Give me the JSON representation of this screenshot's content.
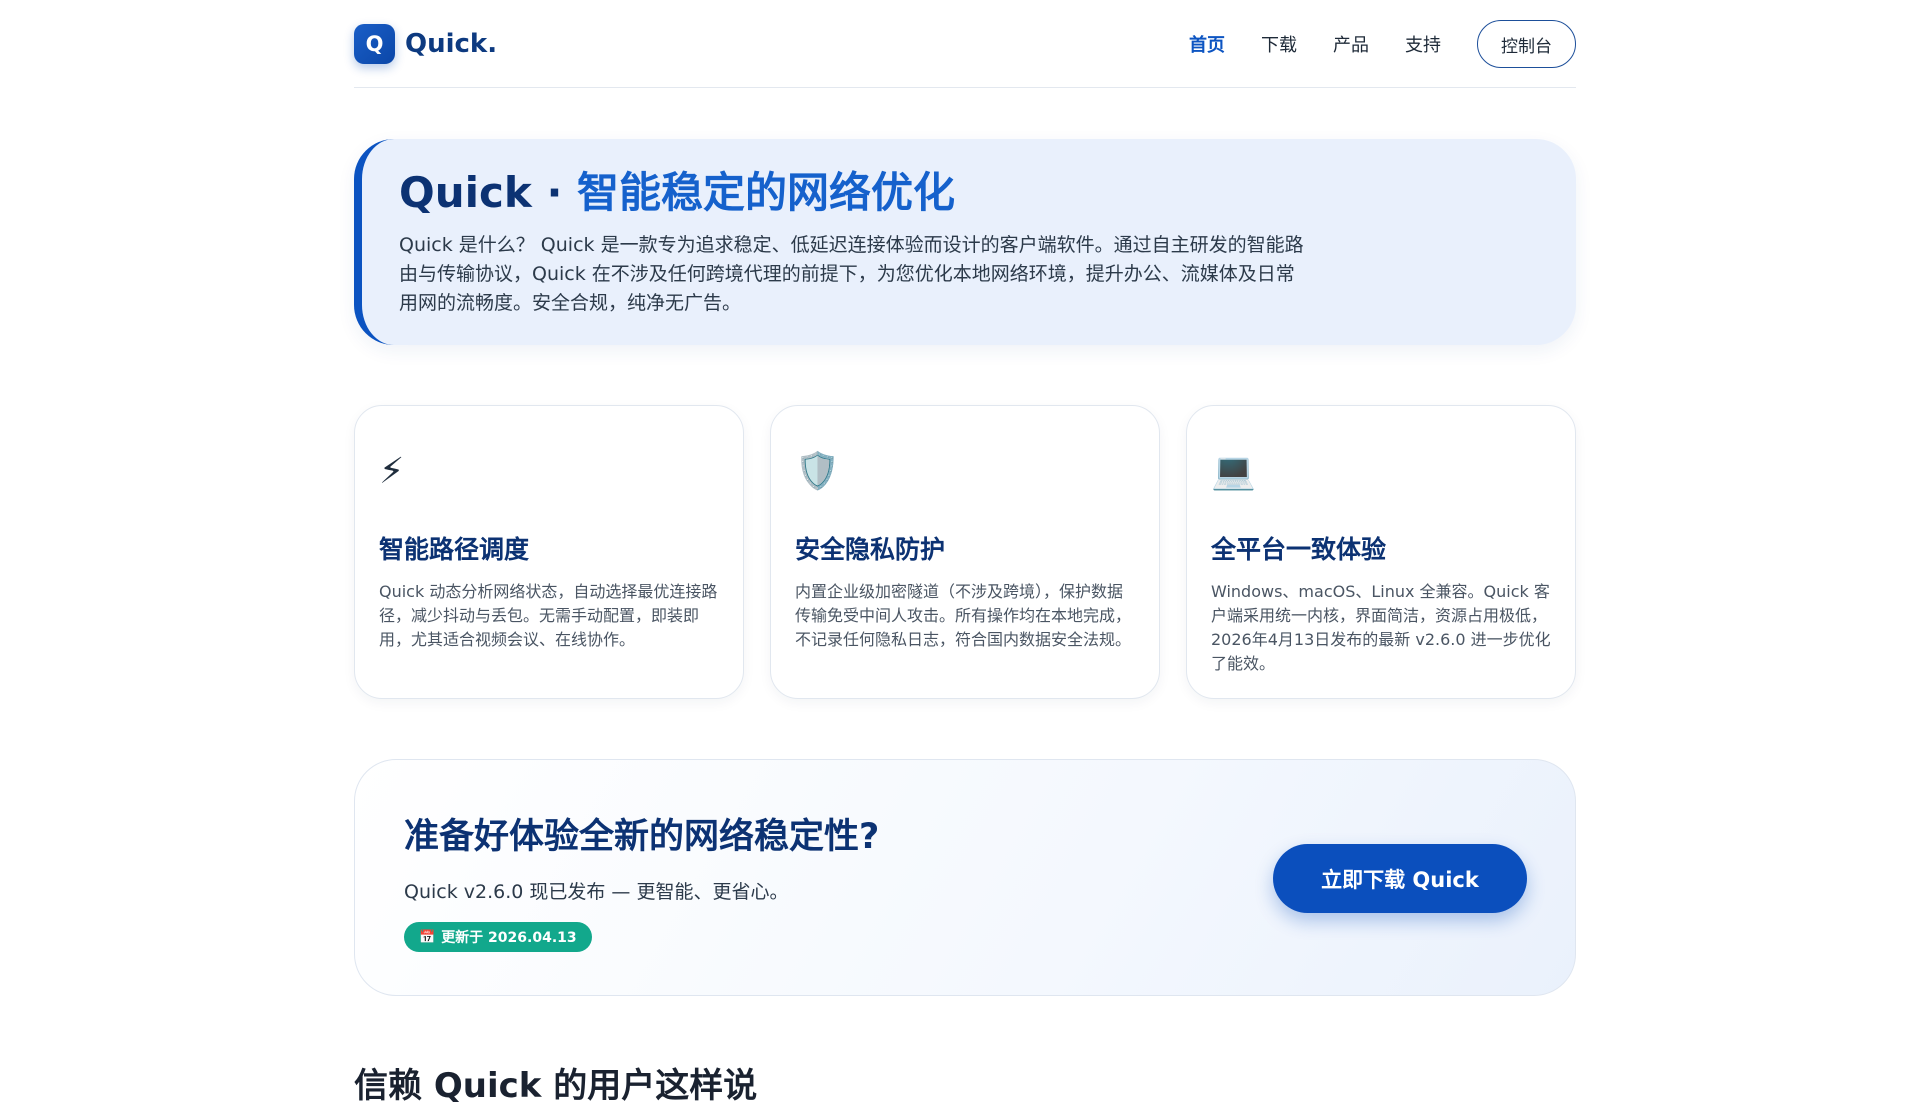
{
  "brand": {
    "logo_letter": "Q",
    "name": "Quick."
  },
  "nav": {
    "links": [
      "首页",
      "下载",
      "产品",
      "支持"
    ],
    "console_label": "控制台"
  },
  "hero": {
    "title_main": "Quick · ",
    "title_accent": "智能稳定的网络优化",
    "description": "Quick 是什么？ Quick 是一款专为追求稳定、低延迟连接体验而设计的客户端软件。通过自主研发的智能路由与传输协议，Quick 在不涉及任何跨境代理的前提下，为您优化本地网络环境，提升办公、流媒体及日常用网的流畅度。安全合规，纯净无广告。"
  },
  "features": [
    {
      "icon": "lightning-icon",
      "glyph": "⚡",
      "title": "智能路径调度",
      "text": "Quick 动态分析网络状态，自动选择最优连接路径，减少抖动与丢包。无需手动配置，即装即用，尤其适合视频会议、在线协作。"
    },
    {
      "icon": "shield-icon",
      "glyph": "🛡️",
      "title": "安全隐私防护",
      "text": "内置企业级加密隧道（不涉及跨境），保护数据传输免受中间人攻击。所有操作均在本地完成，不记录任何隐私日志，符合国内数据安全法规。"
    },
    {
      "icon": "laptop-icon",
      "glyph": "💻",
      "title": "全平台一致体验",
      "text": "Windows、macOS、Linux 全兼容。Quick 客户端采用统一内核，界面简洁，资源占用极低，2026年4月13日发布的最新 v2.6.0 进一步优化了能效。"
    }
  ],
  "cta": {
    "title": "准备好体验全新的网络稳定性?",
    "subtitle": "Quick v2.6.0 现已发布 — 更智能、更省心。",
    "badge_icon": "📅",
    "badge": "更新于 2026.04.13",
    "button": "立即下载 Quick"
  },
  "testimonials": {
    "title": "信赖 Quick 的用户这样说"
  },
  "colors": {
    "primary": "#0b4fbd",
    "heading": "#0c3273",
    "badge": "#12a88c",
    "hero_bg": "#e9f0fc"
  }
}
